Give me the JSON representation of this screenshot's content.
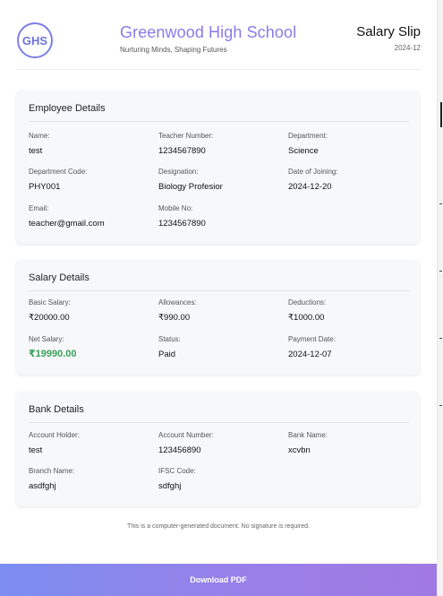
{
  "header": {
    "logo_text": "GHS",
    "school_name": "Greenwood High School",
    "tagline": "Nurturing Minds, Shaping Futures",
    "slip_title": "Salary Slip",
    "period": "2024-12"
  },
  "employee": {
    "title": "Employee Details",
    "name_label": "Name:",
    "name": "test",
    "teacher_number_label": "Teacher Number:",
    "teacher_number": "1234567890",
    "department_label": "Department:",
    "department": "Science",
    "department_code_label": "Department Code:",
    "department_code": "PHY001",
    "designation_label": "Designation:",
    "designation": "Biology Profesior",
    "date_of_joining_label": "Date of Joining:",
    "date_of_joining": "2024-12-20",
    "email_label": "Email:",
    "email": "teacher@gmail.com",
    "mobile_label": "Mobile No:",
    "mobile": "1234567890"
  },
  "salary": {
    "title": "Salary Details",
    "basic_label": "Basic Salary:",
    "basic": "₹20000.00",
    "allowances_label": "Allowances:",
    "allowances": "₹990.00",
    "deductions_label": "Deductions:",
    "deductions": "₹1000.00",
    "net_label": "Net Salary:",
    "net": "₹19990.00",
    "status_label": "Status:",
    "status": "Paid",
    "payment_date_label": "Payment Date:",
    "payment_date": "2024-12-07"
  },
  "bank": {
    "title": "Bank Details",
    "holder_label": "Account Holder:",
    "holder": "test",
    "account_number_label": "Account Number:",
    "account_number": "123456890",
    "bank_name_label": "Bank Name:",
    "bank_name": "xcvbn",
    "branch_label": "Branch Name:",
    "branch": "asdfghj",
    "ifsc_label": "IFSC Code:",
    "ifsc": "sdfghj"
  },
  "footer_note": "This is a computer-generated document. No signature is required.",
  "download_label": "Download PDF",
  "colors": {
    "accent": "#8a7be8",
    "net_salary": "#3aa05a",
    "download_gradient_start": "#7c8df0",
    "download_gradient_end": "#a07ae2"
  }
}
